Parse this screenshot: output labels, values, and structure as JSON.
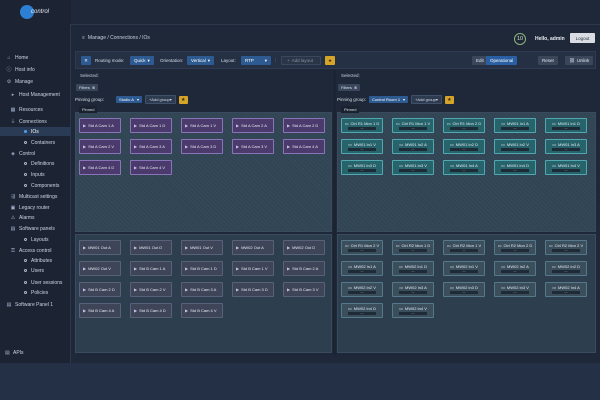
{
  "brand": {
    "logo_text": "control"
  },
  "header": {
    "breadcrumb": "Manage / Connections / IOs",
    "count": "10",
    "greeting": "Hello, admin",
    "logout": "Logout"
  },
  "sidebar": {
    "items": [
      {
        "label": "Home",
        "icon": "home-icon"
      },
      {
        "label": "Host info",
        "icon": "info-icon"
      },
      {
        "label": "Manage",
        "icon": "gear-icon"
      },
      {
        "label": "Host Management",
        "icon": "caret-icon"
      },
      {
        "label": "Resources",
        "icon": "grid-icon"
      },
      {
        "label": "Connections",
        "icon": "plug-icon"
      },
      {
        "label": "IOs",
        "icon": "dot-icon"
      },
      {
        "label": "Containers",
        "icon": "dot-icon"
      },
      {
        "label": "Control",
        "icon": "control-icon"
      },
      {
        "label": "Definitions",
        "icon": "dot-icon"
      },
      {
        "label": "Inputs",
        "icon": "dot-icon"
      },
      {
        "label": "Components",
        "icon": "dot-icon"
      },
      {
        "label": "Multicast settings",
        "icon": "multicast-icon"
      },
      {
        "label": "Legacy router",
        "icon": "router-icon"
      },
      {
        "label": "Alarms",
        "icon": "bell-icon"
      },
      {
        "label": "Software panels",
        "icon": "panel-icon"
      },
      {
        "label": "Layouts",
        "icon": "dot-icon"
      },
      {
        "label": "Access control",
        "icon": "lock-icon"
      },
      {
        "label": "Attributes",
        "icon": "dot-icon"
      },
      {
        "label": "Users",
        "icon": "dot-icon"
      },
      {
        "label": "User sessions",
        "icon": "dot-icon"
      },
      {
        "label": "Policies",
        "icon": "dot-icon"
      },
      {
        "label": "Software Panel 1",
        "icon": "panel-icon"
      }
    ],
    "apis": "APIs"
  },
  "toolbar": {
    "routing_label": "Routing mode:",
    "routing_value": "Quick",
    "orientation_label": "Orientation:",
    "orientation_value": "Vertical",
    "layout_label": "Layout:",
    "layout_value": "RTP",
    "add_layout": "Add layout",
    "edit": "Edit",
    "operational": "Operational",
    "reset": "Reset",
    "unlink": "Unlink"
  },
  "left": {
    "selected": "Selected:",
    "filters": "Filters",
    "pinning_label": "Pinning group:",
    "pinning_value": "Studio A",
    "add_group": "Add group",
    "pinned": "Pinned",
    "top_cards": [
      "Std A Cam 1 A",
      "Std A Cam 1 D",
      "Std A Cam 1 V",
      "Std A Cam 2 A",
      "Std A Cam 2 D",
      "Std A Cam 2 V",
      "Std A Cam 3 A",
      "Std A Cam 3 D",
      "Std A Cam 3 V",
      "Std A Cam 4 A",
      "Std A Cam 4 D",
      "Std A Cam 4 V"
    ],
    "bottom_cards": [
      "MW01 Out A",
      "MW01 Out D",
      "MW01 Out V",
      "MW02 Out A",
      "MW02 Out D",
      "MW02 Out V",
      "Std B Cam 1 A",
      "Std B Cam 1 D",
      "Std B Cam 1 V",
      "Std B Cam 2 A",
      "Std B Cam 2 D",
      "Std B Cam 2 V",
      "Std B Cam 3 A",
      "Std B Cam 3 D",
      "Std B Cam 3 V",
      "Std B Cam 4 A",
      "Std B Cam 4 D",
      "Std B Cam 4 V"
    ]
  },
  "right": {
    "selected": "Selected:",
    "filters": "Filters",
    "pinning_label": "Pinning group:",
    "pinning_value": "Control Room 1",
    "add_group": "Add group",
    "pinned": "Pinned",
    "top_cards": [
      "Ctrl R1 Mon 1 D",
      "Ctrl R1 Mon 1 V",
      "Ctrl R1 Mon 2 D",
      "MW01 In1 A",
      "MW01 In1 D",
      "MW01 In1 V",
      "MW01 In2 A",
      "MW01 In2 D",
      "MW01 In2 V",
      "MW01 In3 A",
      "MW01 In3 D",
      "MW01 In3 V",
      "MW01 In4 A",
      "MW01 In4 D",
      "MW01 In4 V"
    ],
    "bottom_cards": [
      "Ctrl R1 Mon 2 V",
      "Ctrl R2 Mon 1 D",
      "Ctrl R2 Mon 1 V",
      "Ctrl R2 Mon 2 D",
      "Ctrl R2 Mon 2 V",
      "MW02 In1 A",
      "MW02 In1 D",
      "MW02 In1 V",
      "MW02 In2 A",
      "MW02 In2 D",
      "MW02 In2 V",
      "MW02 In3 A",
      "MW02 In3 D",
      "MW02 In3 V",
      "MW02 In4 A",
      "MW02 In4 D",
      "MW02 In4 V"
    ],
    "bar_text": "---"
  },
  "colors": {
    "accent": "#2e5a92",
    "star": "#d6a429",
    "purple_card": "#4b3a6c",
    "teal_card": "#27636b"
  }
}
